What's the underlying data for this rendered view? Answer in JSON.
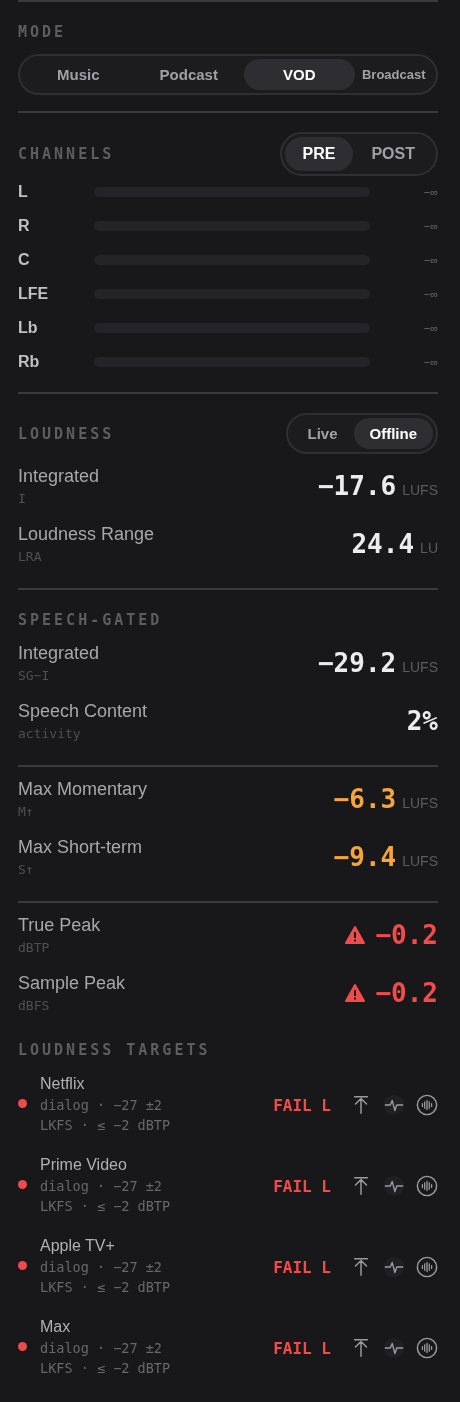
{
  "mode": {
    "title": "MODE",
    "options": [
      {
        "label": "Music",
        "selected": false
      },
      {
        "label": "Podcast",
        "selected": false
      },
      {
        "label": "VOD",
        "selected": true
      },
      {
        "label": "Broadcast",
        "selected": false
      }
    ]
  },
  "channels": {
    "title": "CHANNELS",
    "options": [
      {
        "label": "PRE",
        "selected": true
      },
      {
        "label": "POST",
        "selected": false
      }
    ],
    "meters": [
      {
        "name": "L",
        "level": 0,
        "reading": "−∞"
      },
      {
        "name": "R",
        "level": 0,
        "reading": "−∞"
      },
      {
        "name": "C",
        "level": 0,
        "reading": "−∞"
      },
      {
        "name": "LFE",
        "level": 0,
        "reading": "−∞"
      },
      {
        "name": "Lb",
        "level": 0,
        "reading": "−∞"
      },
      {
        "name": "Rb",
        "level": 0,
        "reading": "−∞"
      }
    ]
  },
  "sections": [
    {
      "title": "LOUDNESS",
      "options": [
        {
          "label": "Live",
          "selected": false
        },
        {
          "label": "Offline",
          "selected": true
        }
      ],
      "rows": [
        {
          "label": "Integrated",
          "sublabel": "I",
          "value": "−17.6",
          "unit": "LUFS",
          "kind": "normal"
        },
        {
          "label": "Loudness Range",
          "sublabel": "LRA",
          "value": "24.4",
          "unit": "LU",
          "kind": "normal"
        }
      ]
    },
    {
      "title": "SPEECH-GATED",
      "rows": [
        {
          "label": "Integrated",
          "sublabel": "SG−I",
          "value": "−29.2",
          "unit": "LUFS",
          "kind": "normal"
        },
        {
          "label": "Speech Content",
          "sublabel": "activity",
          "value": "2%",
          "kind": "normal"
        }
      ]
    },
    {
      "rows": [
        {
          "label": "Max Momentary",
          "sublabel": "M↑",
          "value": "−6.3",
          "unit": "LUFS",
          "kind": "warning"
        },
        {
          "label": "Max Short-term",
          "sublabel": "S↑",
          "value": "−9.4",
          "unit": "LUFS",
          "kind": "warning"
        }
      ]
    },
    {
      "rows": [
        {
          "label": "True Peak",
          "sublabel": "dBTP",
          "value": "−0.2",
          "kind": "fail"
        },
        {
          "label": "Sample Peak",
          "sublabel": "dBFS",
          "value": "−0.2",
          "kind": "fail"
        }
      ]
    }
  ],
  "targets": {
    "title": "LOUDNESS TARGETS",
    "items": [
      {
        "name": "Netflix",
        "spec": "dialog · −27 ±2 LKFS · ≤ −2 dBTP",
        "status": "FAIL L",
        "color": "#f04a4a"
      },
      {
        "name": "Prime Video",
        "spec": "dialog · −27 ±2 LKFS · ≤ −2 dBTP",
        "status": "FAIL L",
        "color": "#f04a4a"
      },
      {
        "name": "Apple TV+",
        "spec": "dialog · −27 ±2 LKFS · ≤ −2 dBTP",
        "status": "FAIL L",
        "color": "#f04a4a"
      },
      {
        "name": "Max",
        "spec": "dialog · −27 ±2 LKFS · ≤ −2 dBTP",
        "status": "FAIL L",
        "color": "#f04a4a"
      }
    ]
  }
}
